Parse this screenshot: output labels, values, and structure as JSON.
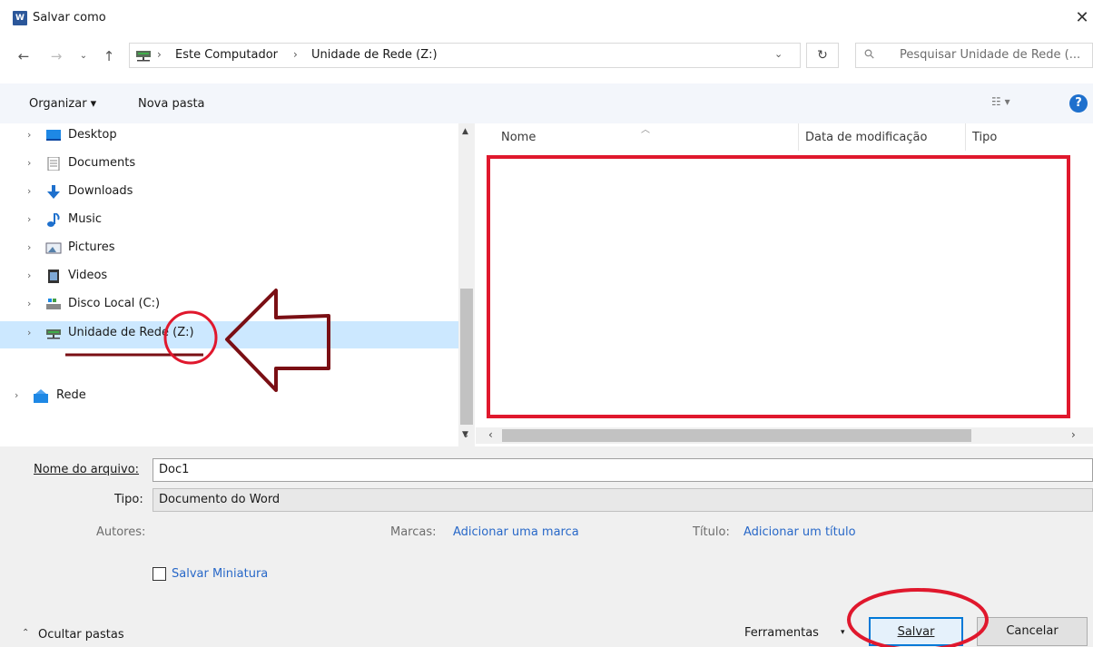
{
  "window": {
    "title": "Salvar como",
    "app_icon_text": "W"
  },
  "nav": {
    "breadcrumbs": [
      "Este Computador",
      "Unidade de Rede (Z:)"
    ],
    "search_placeholder": "Pesquisar Unidade de Rede (..."
  },
  "toolbar": {
    "organize_label": "Organizar ▾",
    "new_folder_label": "Nova pasta"
  },
  "tree": {
    "items": [
      {
        "label": "Desktop",
        "icon": "desktop-icon"
      },
      {
        "label": "Documents",
        "icon": "documents-icon"
      },
      {
        "label": "Downloads",
        "icon": "downloads-icon"
      },
      {
        "label": "Music",
        "icon": "music-icon"
      },
      {
        "label": "Pictures",
        "icon": "pictures-icon"
      },
      {
        "label": "Videos",
        "icon": "videos-icon"
      },
      {
        "label": "Disco Local (C:)",
        "icon": "local-disk-icon"
      },
      {
        "label": "Unidade de Rede (Z:)",
        "icon": "network-drive-icon",
        "selected": true
      },
      {
        "label": "Rede",
        "icon": "network-icon"
      }
    ]
  },
  "list": {
    "columns": [
      "Nome",
      "Data de modificação",
      "Tipo"
    ]
  },
  "form": {
    "filename_label": "Nome do arquivo:",
    "filename_value": "Doc1",
    "type_label": "Tipo:",
    "type_value": "Documento do Word",
    "authors_label": "Autores:",
    "tags_label": "Marcas:",
    "tags_link": "Adicionar uma marca",
    "title_label": "Título:",
    "title_link": "Adicionar um título",
    "thumbnail_label": "Salvar Miniatura"
  },
  "footer": {
    "hide_folders": "Ocultar pastas",
    "tools_label": "Ferramentas",
    "save_label": "Salvar",
    "cancel_label": "Cancelar"
  },
  "colors": {
    "selection": "#cce8ff",
    "annotation_red": "#e0182d",
    "annotation_arrow": "#7a0f14",
    "link": "#2868c8"
  }
}
